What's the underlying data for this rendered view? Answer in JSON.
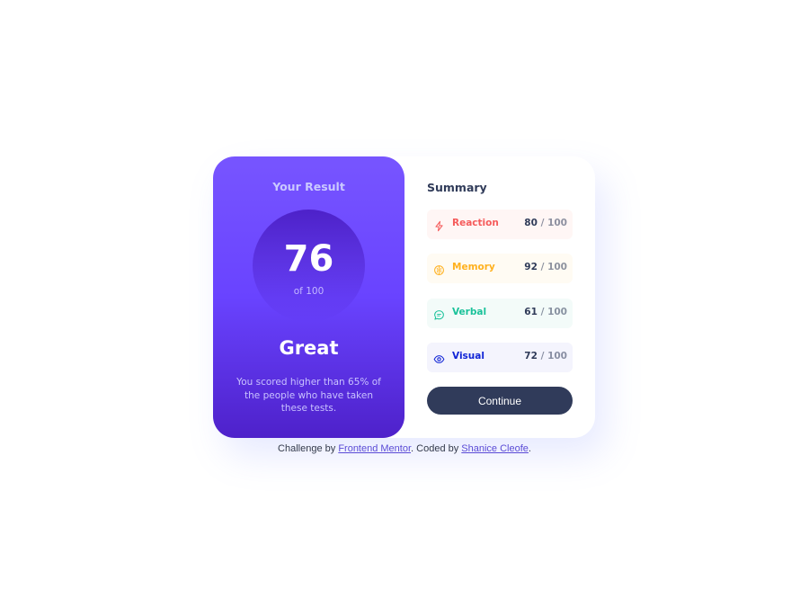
{
  "result": {
    "title": "Your Result",
    "score": "76",
    "max_label": "of 100",
    "rating": "Great",
    "description": "You scored higher than 65% of the people who have taken these tests."
  },
  "summary": {
    "title": "Summary",
    "items": [
      {
        "label": "Reaction",
        "score": "80",
        "max": " / 100",
        "icon": "lightning-icon",
        "color": "#f55b5b",
        "bg": "#fff6f5"
      },
      {
        "label": "Memory",
        "score": "92",
        "max": " / 100",
        "icon": "brain-icon",
        "color": "#ffb11f",
        "bg": "#fffbf3"
      },
      {
        "label": "Verbal",
        "score": "61",
        "max": " / 100",
        "icon": "chat-bubble-icon",
        "color": "#1ac29a",
        "bg": "#f3fbf9"
      },
      {
        "label": "Visual",
        "score": "72",
        "max": " / 100",
        "icon": "eye-icon",
        "color": "#1125d6",
        "bg": "#f4f4fd"
      }
    ]
  },
  "actions": {
    "continue_label": "Continue"
  },
  "footer": {
    "prefix": "Challenge by ",
    "link1": "Frontend Mentor",
    "middle": ". Coded by ",
    "link2": "Shanice Cleofe",
    "suffix": "."
  },
  "colors": {
    "gradient_top": "#7755ff",
    "gradient_bottom": "#4e21ca",
    "button": "#303b5a",
    "dark_text": "#303b59"
  }
}
